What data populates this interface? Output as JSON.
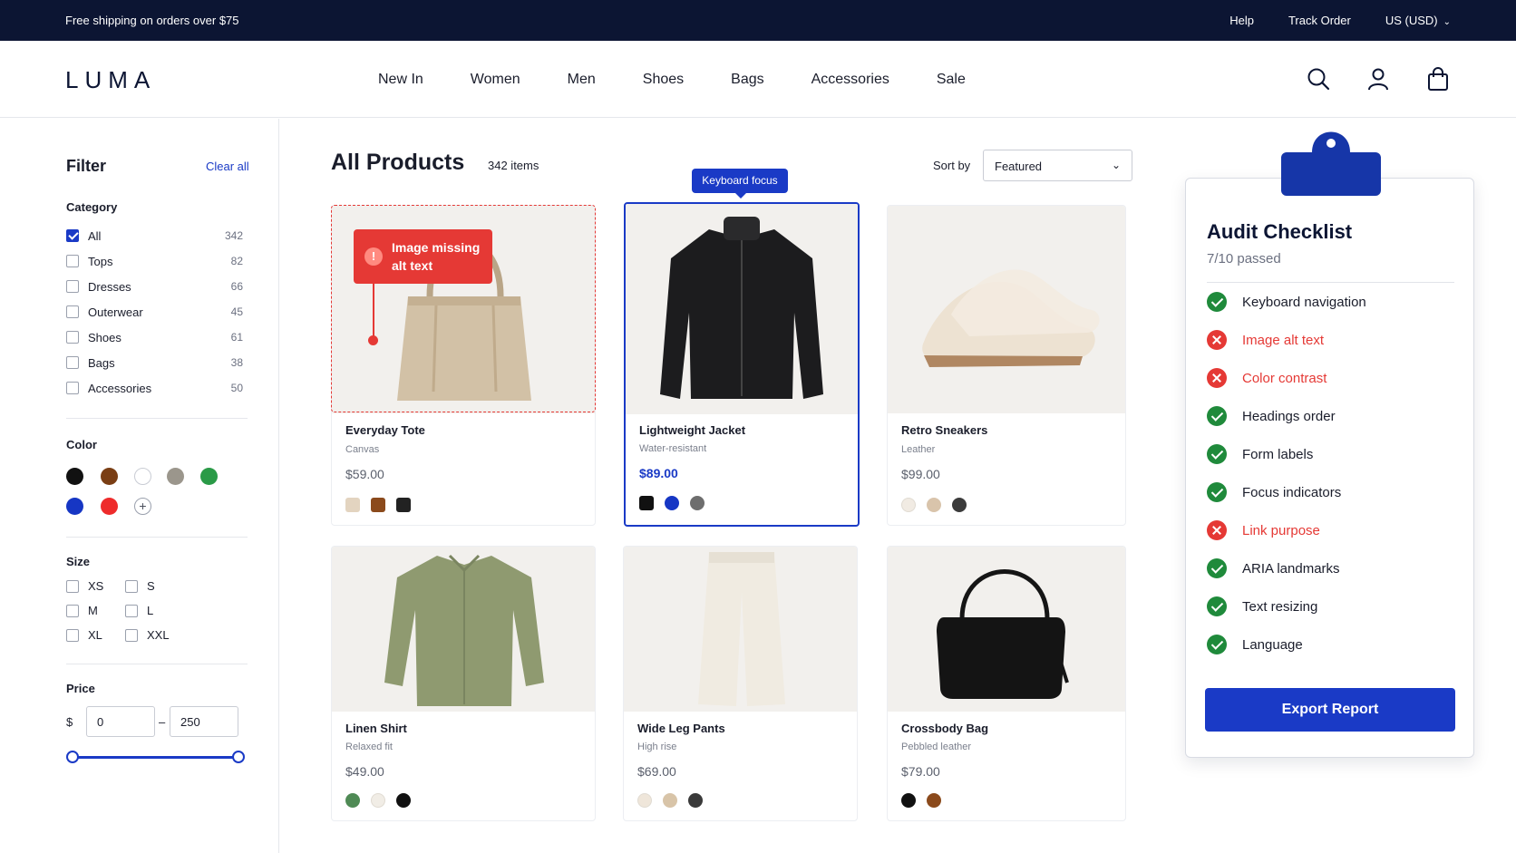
{
  "topbar": {
    "promo": "Free shipping on orders over $75",
    "help": "Help",
    "track_order": "Track Order",
    "currency": "US (USD)"
  },
  "header": {
    "logo": "LUMA",
    "nav": [
      "New In",
      "Women",
      "Men",
      "Shoes",
      "Bags",
      "Accessories",
      "Sale"
    ],
    "icons": [
      "search-icon",
      "account-icon",
      "bag-icon"
    ]
  },
  "filter": {
    "title": "Filter",
    "clear_all": "Clear all",
    "category": {
      "heading": "Category",
      "items": [
        {
          "label": "All",
          "count": "342",
          "checked": true
        },
        {
          "label": "Tops",
          "count": "82",
          "checked": false
        },
        {
          "label": "Dresses",
          "count": "66",
          "checked": false
        },
        {
          "label": "Outerwear",
          "count": "45",
          "checked": false
        },
        {
          "label": "Shoes",
          "count": "61",
          "checked": false
        },
        {
          "label": "Bags",
          "count": "38",
          "checked": false
        },
        {
          "label": "Accessories",
          "count": "50",
          "checked": false
        }
      ]
    },
    "color": {
      "heading": "Color",
      "swatches": [
        "#111111",
        "#7a3e14",
        "#ffffff",
        "#9b968c",
        "#2a9a47",
        "#1636c4",
        "#ee2b2b"
      ],
      "more_label": "+"
    },
    "size": {
      "heading": "Size",
      "options": [
        "XS",
        "S",
        "M",
        "L",
        "XL",
        "XXL"
      ]
    },
    "price": {
      "heading": "Price",
      "currency": "$",
      "min": "0",
      "max": "250",
      "range_low_fraction": 0,
      "range_high_fraction": 1
    }
  },
  "main": {
    "title": "All Products",
    "count": "342 items",
    "sort_label": "Sort by",
    "sort_value": "Featured",
    "keyboard_focus_label": "Keyboard focus",
    "alt_error_label": "Image missing alt text",
    "alt_error_icon": "!",
    "products": [
      {
        "name": "Everyday Tote",
        "sub": "Canvas",
        "price": "$59.00",
        "colors": [
          "#e3d4c0",
          "#8b4a1c",
          "#222222"
        ]
      },
      {
        "name": "Lightweight Jacket",
        "sub": "Water-resistant",
        "price": "$89.00",
        "colors": [
          "#111111",
          "#1636c4",
          "#6e6e6e"
        ]
      },
      {
        "name": "Retro Sneakers",
        "sub": "Leather",
        "price": "$99.00",
        "colors": [
          "#f1ebe3",
          "#d9c4ab",
          "#3b3b3b"
        ]
      },
      {
        "name": "Linen Shirt",
        "sub": "Relaxed fit",
        "price": "$49.00",
        "colors": [
          "#4f8a55",
          "#f1ede6",
          "#111111"
        ]
      },
      {
        "name": "Wide Leg Pants",
        "sub": "High rise",
        "price": "$69.00",
        "colors": [
          "#efe6da",
          "#d8c4a8",
          "#3a3a3a"
        ]
      },
      {
        "name": "Crossbody Bag",
        "sub": "Pebbled leather",
        "price": "$79.00",
        "colors": [
          "#111111",
          "#8b4a1c"
        ]
      }
    ]
  },
  "audit": {
    "title": "Audit Checklist",
    "subtitle": "7/10 passed",
    "items": [
      {
        "label": "Keyboard navigation",
        "status": "pass"
      },
      {
        "label": "Image alt text",
        "status": "fail"
      },
      {
        "label": "Color contrast",
        "status": "fail"
      },
      {
        "label": "Headings order",
        "status": "pass"
      },
      {
        "label": "Form labels",
        "status": "pass"
      },
      {
        "label": "Focus indicators",
        "status": "pass"
      },
      {
        "label": "Link purpose",
        "status": "fail"
      },
      {
        "label": "ARIA landmarks",
        "status": "pass"
      },
      {
        "label": "Text resizing",
        "status": "pass"
      },
      {
        "label": "Language",
        "status": "pass"
      }
    ],
    "export_label": "Export Report"
  },
  "colors": {
    "brand_navy": "#0c1533",
    "accent_blue": "#1a3ac6",
    "error_red": "#e53935",
    "pass_green": "#1f8a3b"
  }
}
